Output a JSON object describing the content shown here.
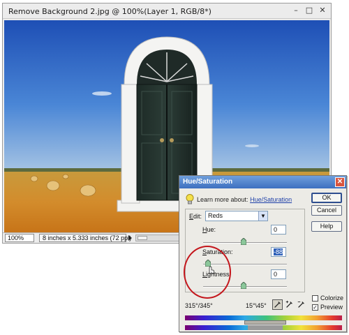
{
  "document": {
    "title": "Remove Background 2.jpg @ 100%(Layer 1, RGB/8*)",
    "controls": {
      "minimize": "–",
      "maximize": "□",
      "close": "✕"
    },
    "status": {
      "zoom": "100%",
      "doc_size": "8 inches x 5.333 inches (72 ppi)"
    }
  },
  "dialog": {
    "title": "Hue/Saturation",
    "learn_prefix": "Learn more about:",
    "learn_link": "Hue/Saturation",
    "edit_label_prefix": "E",
    "edit_label_rest": "dit:",
    "edit_value": "Reds",
    "hue_label_prefix": "H",
    "hue_label_rest": "ue:",
    "hue_value": "0",
    "saturation_label_prefix": "S",
    "saturation_label_rest": "aturation:",
    "saturation_value": "-88",
    "lightness_label_prefix": "Li",
    "lightness_label_rest": "ghtness:",
    "lightness_value": "0",
    "buttons": {
      "ok": "OK",
      "cancel": "Cancel",
      "help": "Help"
    },
    "range_left": "315°/345°",
    "range_right": "15°\\45°",
    "colorize_label": "Colorize",
    "preview_label": "Preview",
    "colorize_checked": false,
    "preview_checked": true,
    "title_color": "#3d6fc0",
    "highlight_color": "#c4161c"
  },
  "icons": {
    "bulb": "lightbulb-icon",
    "eyedropper": "eyedropper-icon",
    "eyedropper_plus": "eyedropper-add-icon",
    "eyedropper_minus": "eyedropper-subtract-icon"
  }
}
